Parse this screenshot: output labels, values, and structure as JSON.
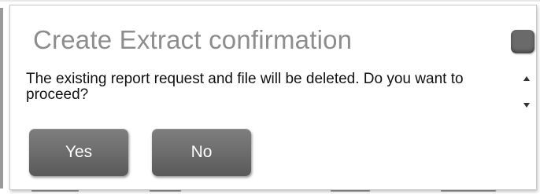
{
  "dialog": {
    "title": "Create Extract confirmation",
    "message": "The existing report request and file will be deleted. Do you want to proceed?",
    "buttons": {
      "yes_label": "Yes",
      "no_label": "No"
    },
    "close_icon": "close-icon"
  },
  "scrollbar": {
    "up_icon": "scroll-up-arrow-icon",
    "down_icon": "scroll-down-arrow-icon"
  },
  "colors": {
    "title": "#8d8d8d",
    "button_background": "#6b6b6b",
    "button_text": "#ffffff",
    "message_text": "#111111"
  }
}
